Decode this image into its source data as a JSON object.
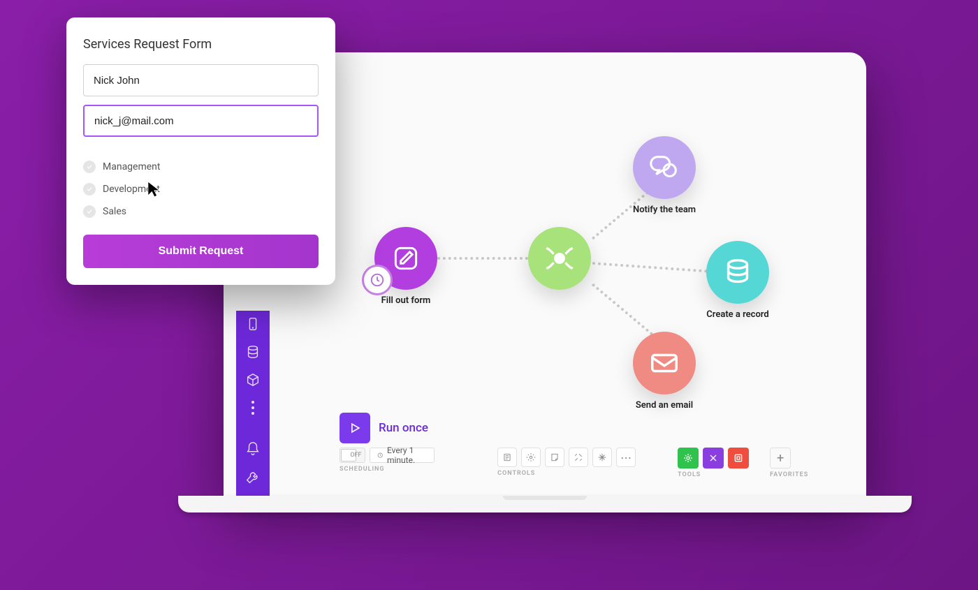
{
  "form": {
    "title": "Services Request Form",
    "name_value": "Nick John",
    "email_value": "nick_j@mail.com",
    "options": {
      "0": "Management",
      "1": "Development",
      "2": "Sales"
    },
    "submit_label": "Submit Request"
  },
  "workflow": {
    "form_node": "Fill out form",
    "notify_node": "Notify the team",
    "create_node": "Create a record",
    "email_node": "Send an email"
  },
  "bottom": {
    "run_label": "Run once",
    "toggle_state": "OFF",
    "schedule_text": "Every 1 minute.",
    "scheduling_label": "SCHEDULING",
    "controls_label": "CONTROLS",
    "tools_label": "TOOLS",
    "favorites_label": "FAVORITES",
    "plus": "+"
  }
}
